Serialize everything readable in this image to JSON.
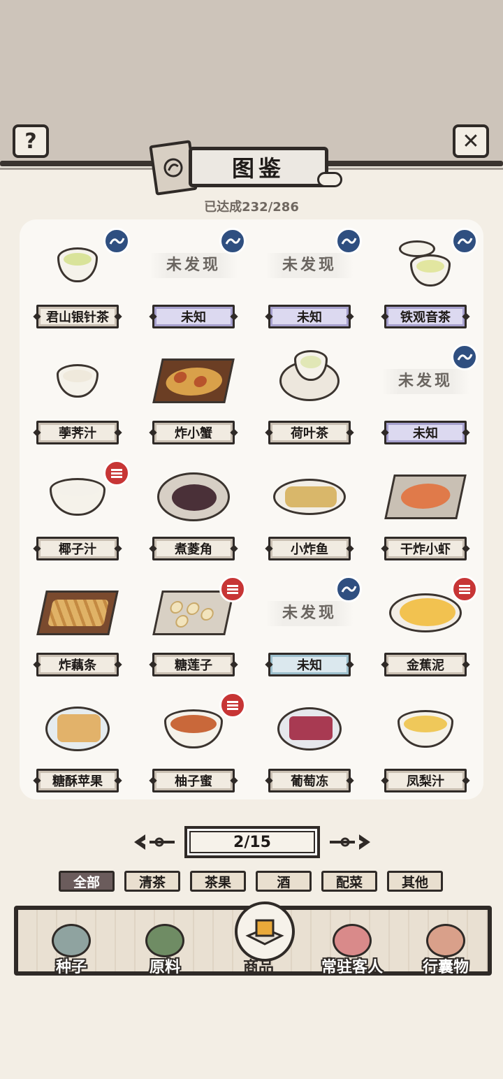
{
  "header": {
    "help_icon": "?",
    "close_icon": "✕",
    "title": "图鉴",
    "progress": "已达成232/286"
  },
  "grid": {
    "undiscovered_text": "未发现",
    "items": [
      {
        "name": "君山银针茶",
        "discovered": true,
        "stamp": "blue",
        "plate": "default",
        "art": "tea-cup-green"
      },
      {
        "name": "未知",
        "discovered": false,
        "stamp": "blue",
        "plate": "purple"
      },
      {
        "name": "未知",
        "discovered": false,
        "stamp": "blue",
        "plate": "purple"
      },
      {
        "name": "铁观音茶",
        "discovered": true,
        "stamp": "blue",
        "plate": "purple",
        "art": "lidded-tea-cup"
      },
      {
        "name": "荸荠汁",
        "discovered": true,
        "stamp": "",
        "plate": "default",
        "art": "white-bowl"
      },
      {
        "name": "炸小蟹",
        "discovered": true,
        "stamp": "",
        "plate": "default",
        "art": "fried-crabs"
      },
      {
        "name": "荷叶茶",
        "discovered": true,
        "stamp": "",
        "plate": "default",
        "art": "lotus-tea"
      },
      {
        "name": "未知",
        "discovered": false,
        "stamp": "blue",
        "plate": "purple"
      },
      {
        "name": "椰子汁",
        "discovered": true,
        "stamp": "red",
        "plate": "default",
        "art": "coconut-juice"
      },
      {
        "name": "煮菱角",
        "discovered": true,
        "stamp": "",
        "plate": "default",
        "art": "water-caltrop"
      },
      {
        "name": "小炸鱼",
        "discovered": true,
        "stamp": "",
        "plate": "default",
        "art": "fried-fish"
      },
      {
        "name": "干炸小虾",
        "discovered": true,
        "stamp": "",
        "plate": "default",
        "art": "fried-shrimp"
      },
      {
        "name": "炸藕条",
        "discovered": true,
        "stamp": "",
        "plate": "default",
        "art": "fried-lotus-strips"
      },
      {
        "name": "糖莲子",
        "discovered": true,
        "stamp": "red",
        "plate": "default",
        "art": "candied-lotus-seeds"
      },
      {
        "name": "未知",
        "discovered": false,
        "stamp": "blue",
        "plate": "teal"
      },
      {
        "name": "金蕉泥",
        "discovered": true,
        "stamp": "red",
        "plate": "default",
        "art": "banana-puree"
      },
      {
        "name": "糖酥苹果",
        "discovered": true,
        "stamp": "",
        "plate": "default",
        "art": "candied-apple"
      },
      {
        "name": "柚子蜜",
        "discovered": true,
        "stamp": "red",
        "plate": "default",
        "art": "pomelo-honey"
      },
      {
        "name": "葡萄冻",
        "discovered": true,
        "stamp": "",
        "plate": "default",
        "art": "grape-jelly"
      },
      {
        "name": "凤梨汁",
        "discovered": true,
        "stamp": "",
        "plate": "default",
        "art": "pineapple-juice"
      }
    ]
  },
  "pager": {
    "page": "2/15",
    "left_icon": "◀",
    "right_icon": "▶"
  },
  "tabs": [
    {
      "label": "全部",
      "active": true
    },
    {
      "label": "清茶",
      "active": false
    },
    {
      "label": "茶果",
      "active": false
    },
    {
      "label": "酒",
      "active": false
    },
    {
      "label": "配菜",
      "active": false
    },
    {
      "label": "其他",
      "active": false
    }
  ],
  "nav": [
    {
      "label": "种子",
      "icon": "seed-jar-icon",
      "color": "#8fa3a0"
    },
    {
      "label": "原料",
      "icon": "leaf-icon",
      "color": "#6f8c64"
    },
    {
      "label": "商品",
      "icon": "goods-box-icon",
      "color": "#e9a93a",
      "active": true
    },
    {
      "label": "常驻客人",
      "icon": "guest-girl-icon",
      "color": "#d98a8a"
    },
    {
      "label": "行囊物",
      "icon": "robe-icon",
      "color": "#d9a08a"
    }
  ],
  "colors": {
    "top_band": "#cdc4ba",
    "background": "#f3eee5",
    "ink": "#2f2a27",
    "stamp_blue": "#2f4f80",
    "stamp_red": "#c73535",
    "tab_active": "#6b5c5c"
  }
}
